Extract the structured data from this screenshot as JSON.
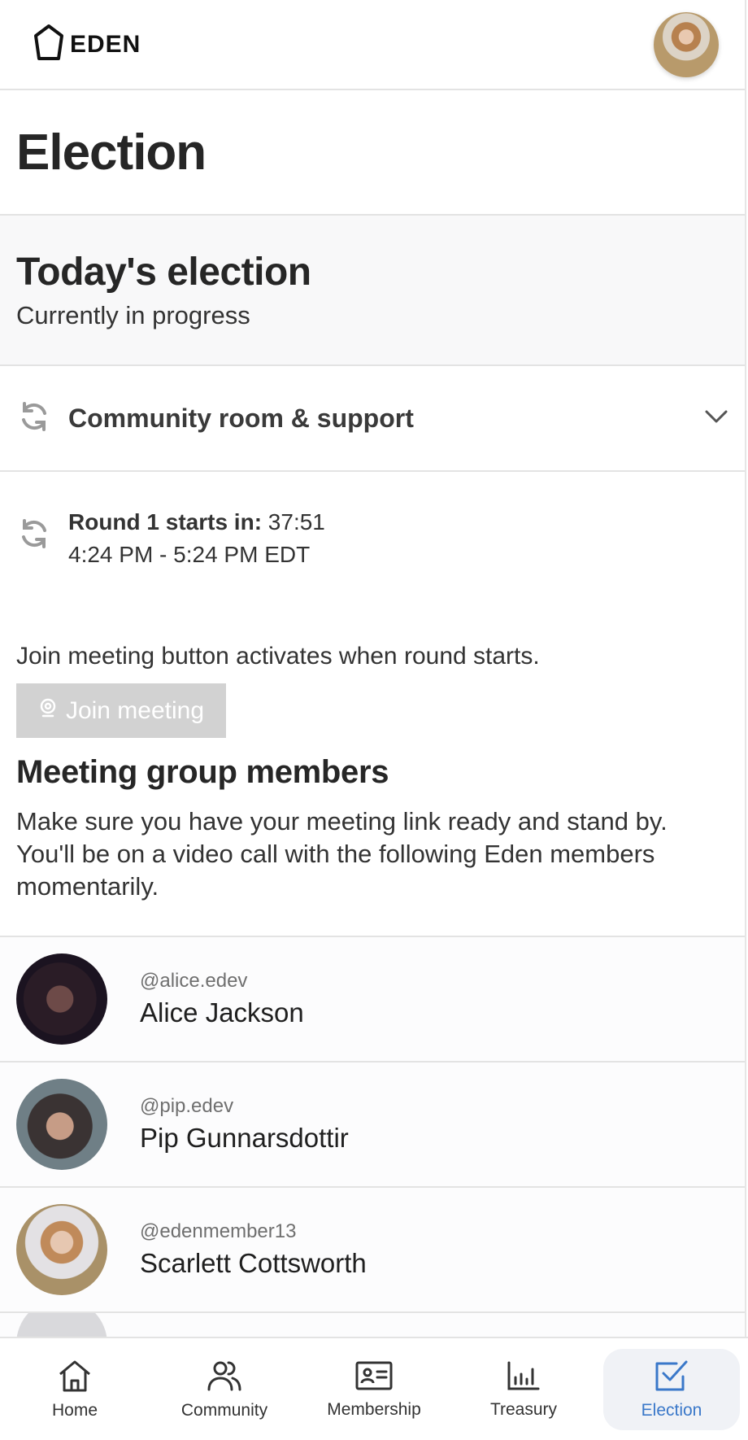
{
  "header": {
    "logo_text": "EDEN",
    "avatar": "user-avatar"
  },
  "page": {
    "title": "Election"
  },
  "today": {
    "title": "Today's election",
    "status": "Currently in progress"
  },
  "community_room": {
    "label": "Community room & support",
    "icon": "refresh-icon",
    "toggle_icon": "chevron-down-icon"
  },
  "round": {
    "label": "Round 1 starts in:",
    "countdown": "37:51",
    "time_range": "4:24 PM - 5:24 PM EDT",
    "icon": "refresh-icon"
  },
  "meeting": {
    "notice": "Join meeting button activates when round starts.",
    "join_label": "Join meeting",
    "join_icon": "webcam-icon",
    "join_enabled": false
  },
  "group": {
    "title": "Meeting group members",
    "description": "Make sure you have your meeting link ready and stand by. You'll be on a video call with the following Eden members momentarily.",
    "members": [
      {
        "handle": "@alice.edev",
        "name": "Alice Jackson"
      },
      {
        "handle": "@pip.edev",
        "name": "Pip Gunnarsdottir"
      },
      {
        "handle": "@edenmember13",
        "name": "Scarlett Cottsworth"
      }
    ]
  },
  "nav": {
    "items": [
      {
        "label": "Home",
        "icon": "home-icon"
      },
      {
        "label": "Community",
        "icon": "users-icon"
      },
      {
        "label": "Membership",
        "icon": "id-card-icon"
      },
      {
        "label": "Treasury",
        "icon": "bar-chart-icon"
      },
      {
        "label": "Election",
        "icon": "checkbox-icon",
        "active": true
      }
    ],
    "active_color": "#3a78c9"
  }
}
